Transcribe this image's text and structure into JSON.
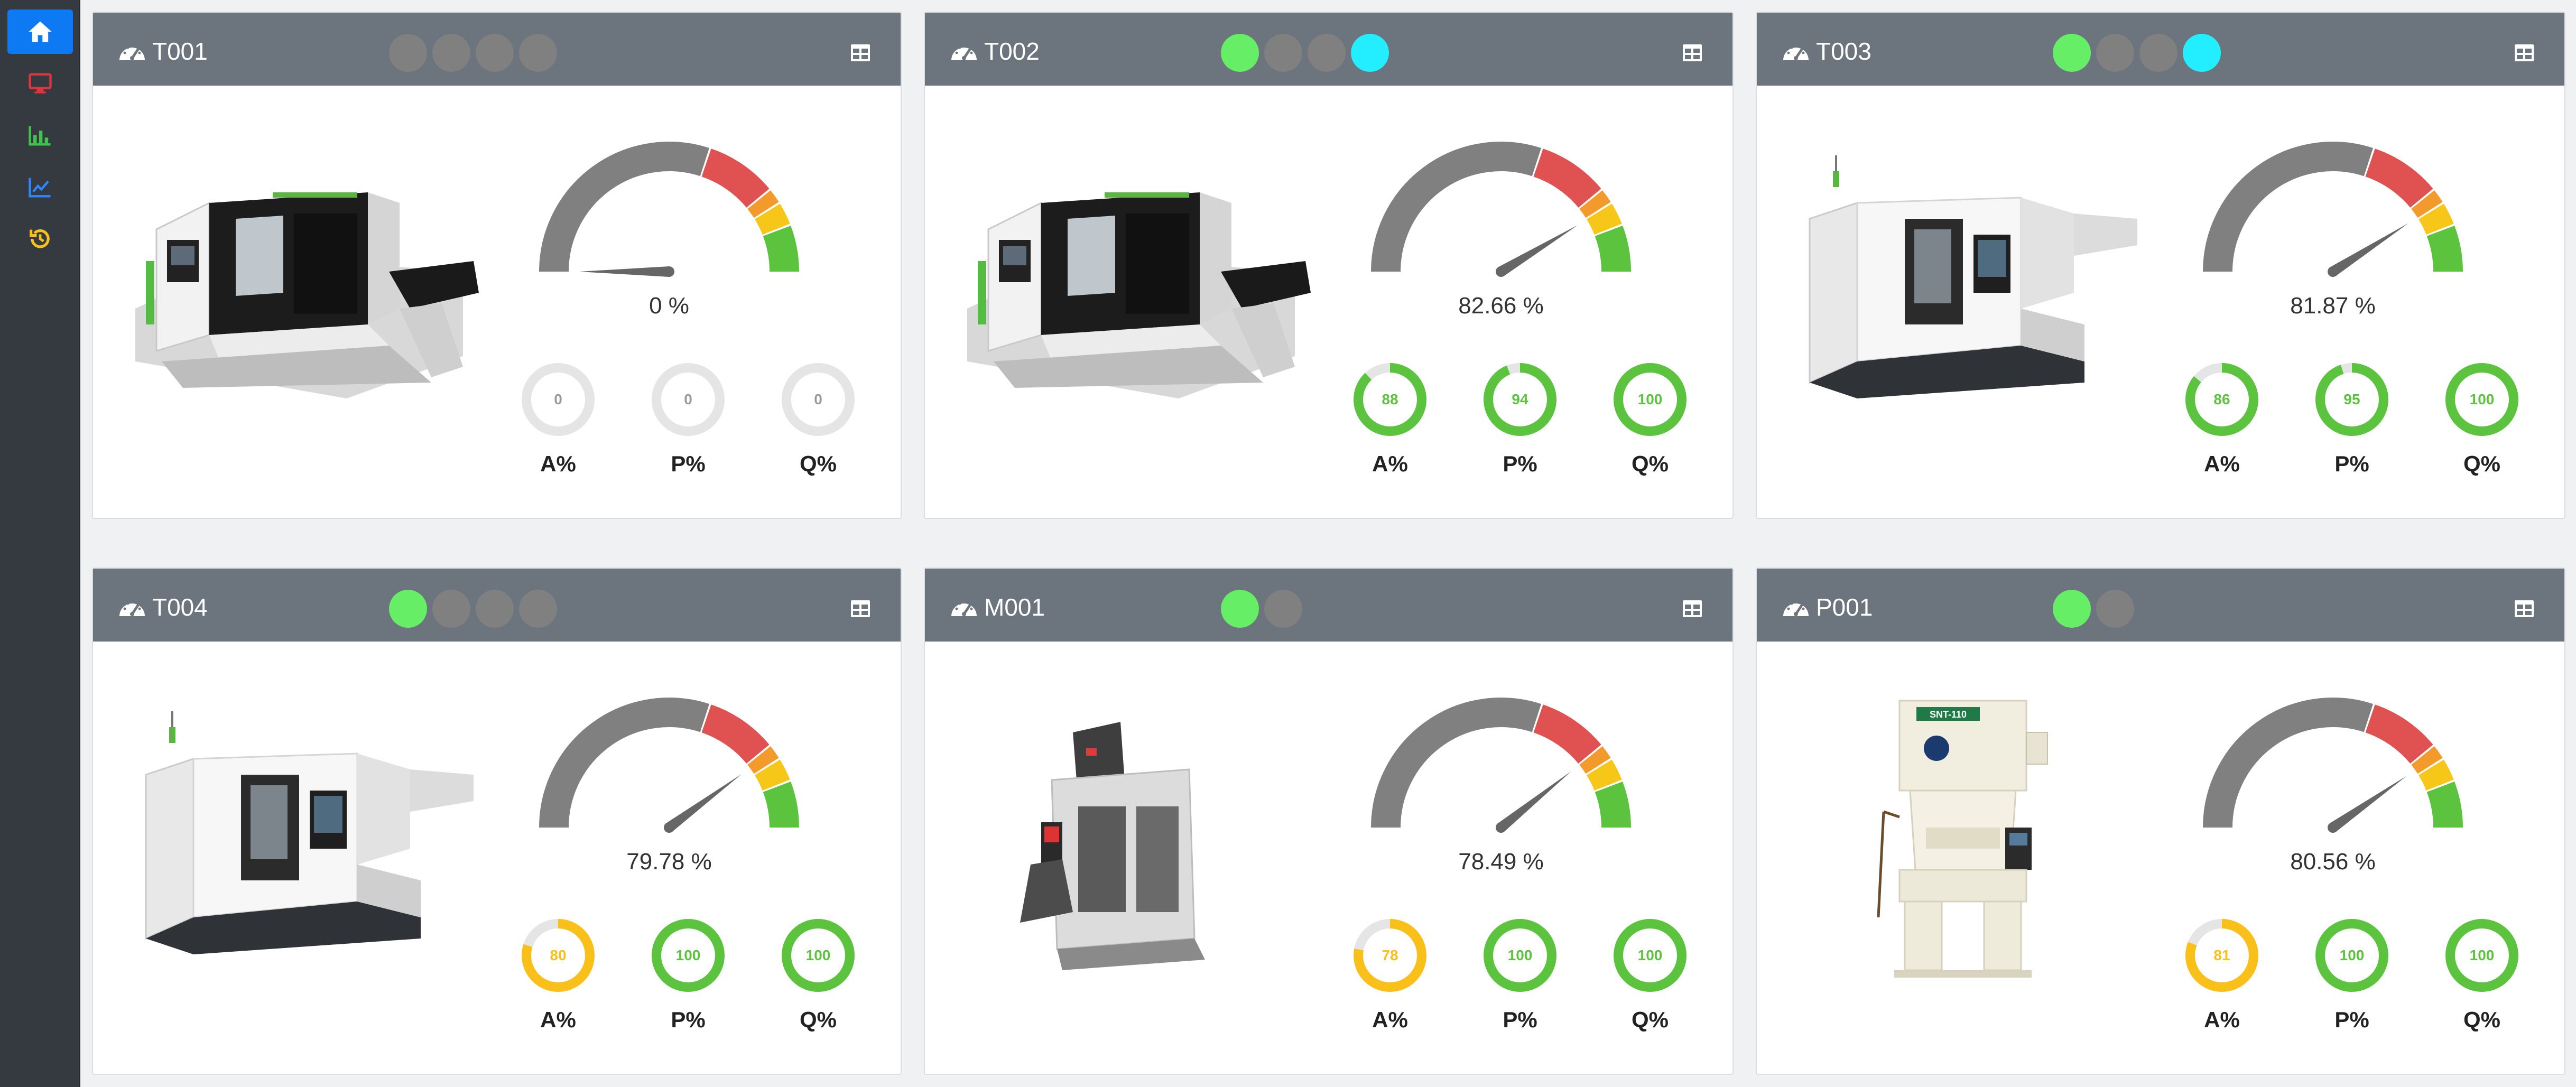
{
  "colors": {
    "sidebar_bg": "#343a40",
    "active_nav": "#0d79f2",
    "header_bg": "#6c757d",
    "light_green": "#66ee66",
    "light_cyan": "#22eeff",
    "light_off": "#808080",
    "kpi_green": "#5cc33f",
    "kpi_amber": "#f9c01a",
    "kpi_gray": "#e5e5e5",
    "gauge_gray": "#808080",
    "gauge_red": "#e05252",
    "gauge_orange": "#f29b2c",
    "gauge_yellow": "#f6c619",
    "gauge_green": "#5cc33f"
  },
  "sidebar": {
    "items": [
      {
        "icon": "home-icon",
        "active": true
      },
      {
        "icon": "monitor-icon",
        "active": false
      },
      {
        "icon": "bar-chart-icon",
        "active": false
      },
      {
        "icon": "line-chart-icon",
        "active": false
      },
      {
        "icon": "history-icon",
        "active": false
      }
    ]
  },
  "machines": [
    {
      "id": "T001",
      "image": "cnc-lathe-machine",
      "lights": [
        "off",
        "off",
        "off",
        "off"
      ],
      "oee_fraction": 0.0,
      "oee_label": "0 %",
      "kpis": [
        {
          "label": "A%",
          "value": "0",
          "fraction": 0.0,
          "tone": "gray"
        },
        {
          "label": "P%",
          "value": "0",
          "fraction": 0.0,
          "tone": "gray"
        },
        {
          "label": "Q%",
          "value": "0",
          "fraction": 0.0,
          "tone": "gray"
        }
      ]
    },
    {
      "id": "T002",
      "image": "cnc-lathe-machine",
      "lights": [
        "green",
        "off",
        "off",
        "cyan"
      ],
      "oee_fraction": 0.8266,
      "oee_label": "82.66 %",
      "kpis": [
        {
          "label": "A%",
          "value": "88",
          "fraction": 0.88,
          "tone": "green"
        },
        {
          "label": "P%",
          "value": "94",
          "fraction": 0.94,
          "tone": "green"
        },
        {
          "label": "Q%",
          "value": "100",
          "fraction": 1.0,
          "tone": "green"
        }
      ]
    },
    {
      "id": "T003",
      "image": "cnc-turning-center",
      "lights": [
        "green",
        "off",
        "off",
        "cyan"
      ],
      "oee_fraction": 0.8187,
      "oee_label": "81.87 %",
      "kpis": [
        {
          "label": "A%",
          "value": "86",
          "fraction": 0.86,
          "tone": "green"
        },
        {
          "label": "P%",
          "value": "95",
          "fraction": 0.95,
          "tone": "green"
        },
        {
          "label": "Q%",
          "value": "100",
          "fraction": 1.0,
          "tone": "green"
        }
      ]
    },
    {
      "id": "T004",
      "image": "cnc-turning-center",
      "lights": [
        "green",
        "off",
        "off",
        "off"
      ],
      "oee_fraction": 0.7978,
      "oee_label": "79.78 %",
      "kpis": [
        {
          "label": "A%",
          "value": "80",
          "fraction": 0.8,
          "tone": "amber"
        },
        {
          "label": "P%",
          "value": "100",
          "fraction": 1.0,
          "tone": "green"
        },
        {
          "label": "Q%",
          "value": "100",
          "fraction": 1.0,
          "tone": "green"
        }
      ]
    },
    {
      "id": "M001",
      "image": "vertical-milling-machine",
      "lights": [
        "green",
        "off"
      ],
      "oee_fraction": 0.7849,
      "oee_label": "78.49 %",
      "kpis": [
        {
          "label": "A%",
          "value": "78",
          "fraction": 0.78,
          "tone": "amber"
        },
        {
          "label": "P%",
          "value": "100",
          "fraction": 1.0,
          "tone": "green"
        },
        {
          "label": "Q%",
          "value": "100",
          "fraction": 1.0,
          "tone": "green"
        }
      ]
    },
    {
      "id": "P001",
      "image": "punch-press-machine",
      "press_plate": "SNT-110",
      "lights": [
        "green",
        "off"
      ],
      "oee_fraction": 0.8056,
      "oee_label": "80.56 %",
      "kpis": [
        {
          "label": "A%",
          "value": "81",
          "fraction": 0.81,
          "tone": "amber"
        },
        {
          "label": "P%",
          "value": "100",
          "fraction": 1.0,
          "tone": "green"
        },
        {
          "label": "Q%",
          "value": "100",
          "fraction": 1.0,
          "tone": "green"
        }
      ]
    }
  ]
}
